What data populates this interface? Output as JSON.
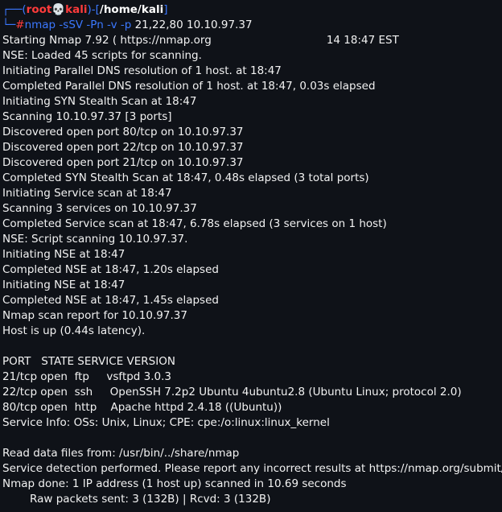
{
  "prompt": {
    "box_top": "┌──(",
    "user": "root",
    "skull": "💀",
    "host": "kali",
    "box_mid": ")-[",
    "path": "/home/kali",
    "box_end": "]",
    "box_bottom": "└─",
    "hash": "#",
    "command": "nmap",
    "flags": " -sSV -Pn -v -p",
    "args": " 21,22,80 10.10.97.37"
  },
  "output": {
    "start_a": "Starting Nmap 7.92 ( https://nmap.org",
    "start_b": "14 18:47 EST",
    "lines_a": [
      "NSE: Loaded 45 scripts for scanning.",
      "Initiating Parallel DNS resolution of 1 host. at 18:47",
      "Completed Parallel DNS resolution of 1 host. at 18:47, 0.03s elapsed",
      "Initiating SYN Stealth Scan at 18:47",
      "Scanning 10.10.97.37 [3 ports]",
      "Discovered open port 80/tcp on 10.10.97.37",
      "Discovered open port 22/tcp on 10.10.97.37",
      "Discovered open port 21/tcp on 10.10.97.37",
      "Completed SYN Stealth Scan at 18:47, 0.48s elapsed (3 total ports)",
      "Initiating Service scan at 18:47",
      "Scanning 3 services on 10.10.97.37",
      "Completed Service scan at 18:47, 6.78s elapsed (3 services on 1 host)",
      "NSE: Script scanning 10.10.97.37.",
      "Initiating NSE at 18:47",
      "Completed NSE at 18:47, 1.20s elapsed",
      "Initiating NSE at 18:47",
      "Completed NSE at 18:47, 1.45s elapsed",
      "Nmap scan report for 10.10.97.37",
      "Host is up (0.44s latency)."
    ],
    "lines_b": [
      "PORT   STATE SERVICE VERSION",
      "21/tcp open  ftp     vsftpd 3.0.3",
      "22/tcp open  ssh     OpenSSH 7.2p2 Ubuntu 4ubuntu2.8 (Ubuntu Linux; protocol 2.0)",
      "80/tcp open  http    Apache httpd 2.4.18 ((Ubuntu))",
      "Service Info: OSs: Unix, Linux; CPE: cpe:/o:linux:linux_kernel"
    ],
    "lines_c": [
      "Read data files from: /usr/bin/../share/nmap",
      "Service detection performed. Please report any incorrect results at https://nmap.org/submit/ .",
      "Nmap done: 1 IP address (1 host up) scanned in 10.69 seconds"
    ],
    "raw_packets": "Raw packets sent: 3 (132B) | Rcvd: 3 (132B)"
  }
}
